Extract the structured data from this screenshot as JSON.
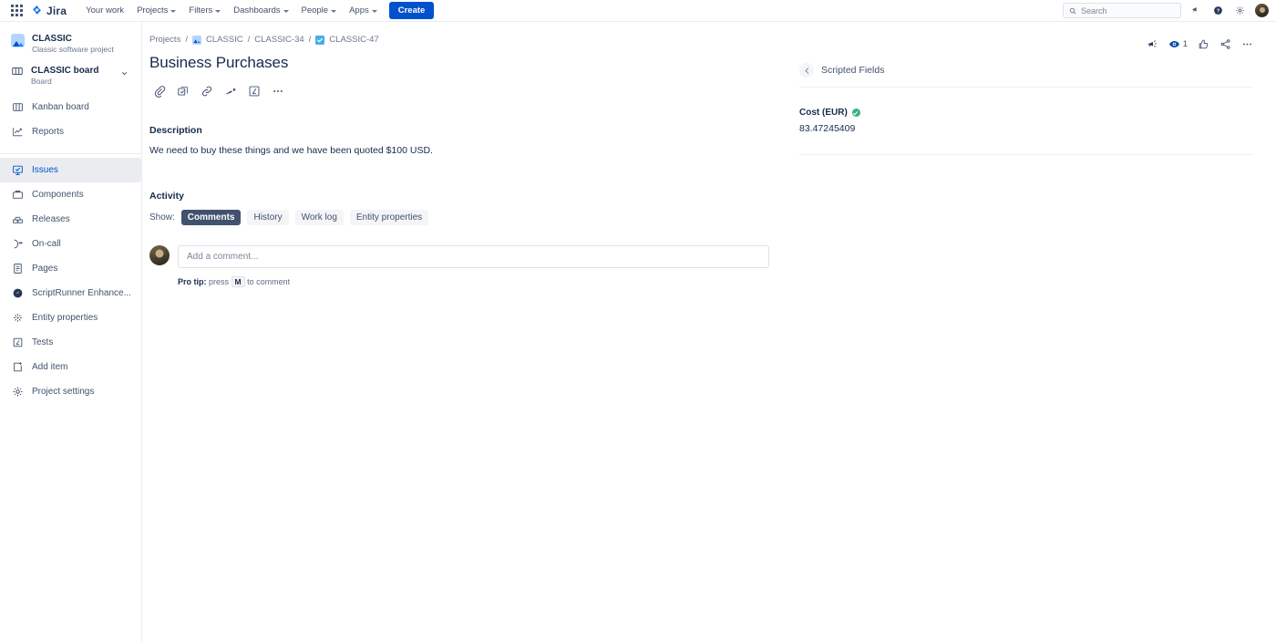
{
  "topnav": {
    "app_switcher": "app-switcher",
    "logo_text": "Jira",
    "items": [
      {
        "label": "Your work",
        "has_caret": false
      },
      {
        "label": "Projects",
        "has_caret": true
      },
      {
        "label": "Filters",
        "has_caret": true
      },
      {
        "label": "Dashboards",
        "has_caret": true
      },
      {
        "label": "People",
        "has_caret": true
      },
      {
        "label": "Apps",
        "has_caret": true
      }
    ],
    "create_label": "Create",
    "search_placeholder": "Search",
    "right_icons": [
      "notifications-icon",
      "help-icon",
      "settings-icon",
      "profile-avatar"
    ]
  },
  "sidebar": {
    "project": {
      "name": "CLASSIC",
      "subtitle": "Classic software project"
    },
    "board": {
      "name": "CLASSIC board",
      "subtitle": "Board"
    },
    "top_items": [
      {
        "label": "Kanban board",
        "icon": "board-icon",
        "active": false
      },
      {
        "label": "Reports",
        "icon": "reports-icon",
        "active": false
      }
    ],
    "items": [
      {
        "label": "Issues",
        "icon": "issues-icon",
        "active": true
      },
      {
        "label": "Components",
        "icon": "components-icon",
        "active": false
      },
      {
        "label": "Releases",
        "icon": "releases-icon",
        "active": false
      },
      {
        "label": "On-call",
        "icon": "oncall-icon",
        "active": false
      },
      {
        "label": "Pages",
        "icon": "pages-icon",
        "active": false
      },
      {
        "label": "ScriptRunner Enhance...",
        "icon": "scriptrunner-icon",
        "active": false
      },
      {
        "label": "Entity properties",
        "icon": "entity-properties-icon",
        "active": false
      },
      {
        "label": "Tests",
        "icon": "tests-icon",
        "active": false
      },
      {
        "label": "Add item",
        "icon": "add-item-icon",
        "active": false
      },
      {
        "label": "Project settings",
        "icon": "settings-gear-icon",
        "active": false
      }
    ]
  },
  "issue": {
    "breadcrumbs": [
      {
        "label": "Projects",
        "icon": null
      },
      {
        "label": "CLASSIC",
        "icon": "project-avatar-icon"
      },
      {
        "label": "CLASSIC-34",
        "icon": null
      },
      {
        "label": "CLASSIC-47",
        "icon": "task-type-icon"
      }
    ],
    "title": "Business Purchases",
    "actions": [
      {
        "name": "attach-button",
        "icon": "paperclip-icon"
      },
      {
        "name": "add-child-issue-button",
        "icon": "child-issue-icon"
      },
      {
        "name": "link-issue-button",
        "icon": "link-icon"
      },
      {
        "name": "create-branch-button",
        "icon": "branch-icon"
      },
      {
        "name": "test-button",
        "icon": "test-icon"
      },
      {
        "name": "more-actions-button",
        "icon": "ellipsis-icon"
      }
    ],
    "description_label": "Description",
    "description_text": "We need to buy these things and we have been quoted $100 USD.",
    "activity_label": "Activity",
    "show_label": "Show:",
    "tabs": [
      {
        "label": "Comments",
        "active": true
      },
      {
        "label": "History",
        "active": false
      },
      {
        "label": "Work log",
        "active": false
      },
      {
        "label": "Entity properties",
        "active": false
      }
    ],
    "comment_placeholder": "Add a comment...",
    "protip_prefix": "Pro tip:",
    "protip_mid": "press",
    "protip_key": "M",
    "protip_suffix": "to comment"
  },
  "panel": {
    "tools": [
      {
        "name": "give-feedback-button",
        "icon": "megaphone-icon",
        "count": null
      },
      {
        "name": "watch-button",
        "icon": "eye-icon",
        "count": "1"
      },
      {
        "name": "vote-button",
        "icon": "thumbs-up-icon",
        "count": null
      },
      {
        "name": "share-button",
        "icon": "share-icon",
        "count": null
      },
      {
        "name": "panel-more-button",
        "icon": "ellipsis-icon",
        "count": null
      }
    ],
    "back_icon": "arrow-left-icon",
    "title": "Scripted Fields",
    "fields": [
      {
        "name": "Cost (EUR)",
        "value": "83.47245409",
        "badge": "verified-check"
      }
    ]
  },
  "colors": {
    "brand": "#0052cc",
    "nav_text": "#42526e",
    "success": "#36b37e",
    "tab_active_bg": "#42526e"
  }
}
